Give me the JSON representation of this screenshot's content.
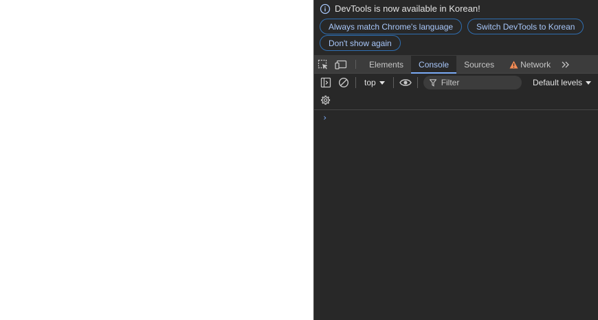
{
  "infobar": {
    "message": "DevTools is now available in Korean!",
    "buttons": {
      "always_match": "Always match Chrome's language",
      "switch": "Switch DevTools to Korean",
      "dont_show": "Don't show again"
    }
  },
  "tabs": {
    "elements": "Elements",
    "console": "Console",
    "sources": "Sources",
    "network": "Network"
  },
  "console_toolbar": {
    "context": "top",
    "filter_placeholder": "Filter",
    "levels": "Default levels"
  },
  "console": {
    "prompt": "›"
  },
  "colors": {
    "panel_bg": "#282828",
    "tabbar_bg": "#3c3c3c",
    "accent": "#a8c7fa",
    "warning": "#f28b54"
  }
}
